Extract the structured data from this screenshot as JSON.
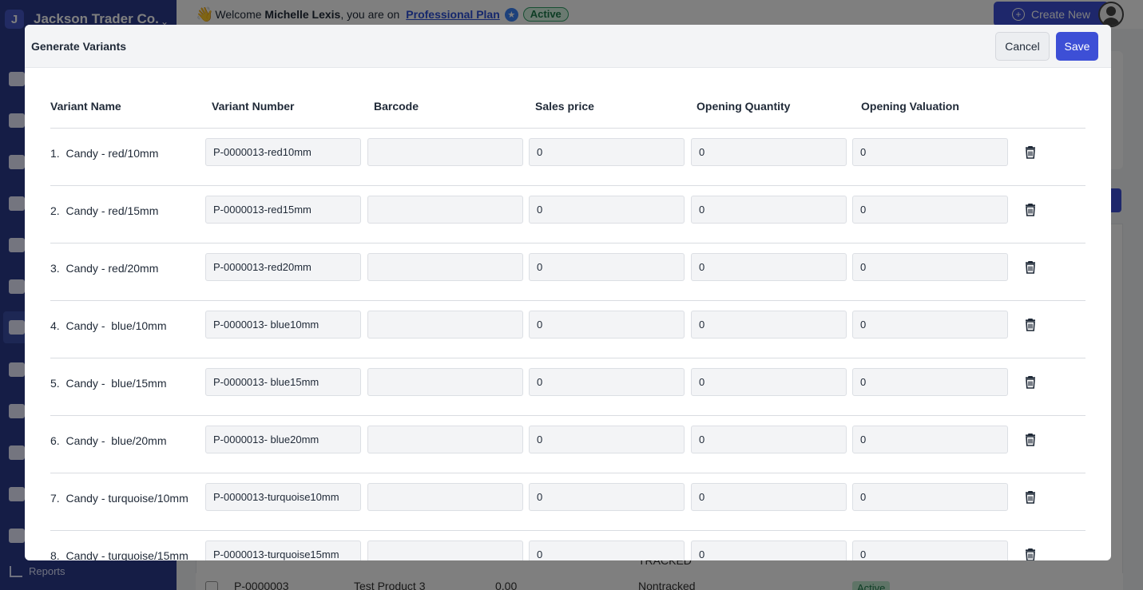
{
  "sidebar": {
    "company_initial": "J",
    "company_name": "Jackson Trader Co.",
    "reports_label": "Reports"
  },
  "topbar": {
    "welcome": "Welcome",
    "user_name": "Michelle Lexis",
    "on_text": ", you are on",
    "plan_name": "Professional Plan",
    "plan_status": "Active",
    "create_new_label": "Create New"
  },
  "background_table": {
    "row_sku": "P-0000003",
    "row_name": "Test Product 3",
    "row_price": "0.00",
    "row_tracking": "Nontracked",
    "tracked_text": "TRACKED",
    "row_status": "Active"
  },
  "modal": {
    "title": "Generate Variants",
    "cancel_label": "Cancel",
    "save_label": "Save",
    "columns": {
      "name": "Variant Name",
      "number": "Variant Number",
      "barcode": "Barcode",
      "sales_price": "Sales price",
      "opening_quantity": "Opening Quantity",
      "opening_valuation": "Opening Valuation"
    },
    "variants": [
      {
        "label": "1.  Candy - red/10mm",
        "number": "P-0000013-red10mm",
        "barcode": "",
        "sales_price": "0",
        "opening_quantity": "0",
        "opening_valuation": "0"
      },
      {
        "label": "2.  Candy - red/15mm",
        "number": "P-0000013-red15mm",
        "barcode": "",
        "sales_price": "0",
        "opening_quantity": "0",
        "opening_valuation": "0"
      },
      {
        "label": "3.  Candy - red/20mm",
        "number": "P-0000013-red20mm",
        "barcode": "",
        "sales_price": "0",
        "opening_quantity": "0",
        "opening_valuation": "0"
      },
      {
        "label": "4.  Candy -  blue/10mm",
        "number": "P-0000013- blue10mm",
        "barcode": "",
        "sales_price": "0",
        "opening_quantity": "0",
        "opening_valuation": "0"
      },
      {
        "label": "5.  Candy -  blue/15mm",
        "number": "P-0000013- blue15mm",
        "barcode": "",
        "sales_price": "0",
        "opening_quantity": "0",
        "opening_valuation": "0"
      },
      {
        "label": "6.  Candy -  blue/20mm",
        "number": "P-0000013- blue20mm",
        "barcode": "",
        "sales_price": "0",
        "opening_quantity": "0",
        "opening_valuation": "0"
      },
      {
        "label": "7.  Candy - turquoise/10mm",
        "number": "P-0000013-turquoise10mm",
        "barcode": "",
        "sales_price": "0",
        "opening_quantity": "0",
        "opening_valuation": "0"
      },
      {
        "label": "8.  Candy - turquoise/15mm",
        "number": "P-0000013-turquoise15mm",
        "barcode": "",
        "sales_price": "0",
        "opening_quantity": "0",
        "opening_valuation": "0"
      }
    ]
  },
  "colors": {
    "primary": "#3d4fd6",
    "sidebar": "#2b3a8c",
    "active_badge": "#d7f5e3"
  },
  "icons": [
    "dashboard-icon",
    "quotes-icon",
    "invoice-icon",
    "purchase-order-icon",
    "bills-icon",
    "contacts-icon",
    "products-icon",
    "bank-icon",
    "tags-icon",
    "shipping-icon",
    "warehouse-icon",
    "apps-icon",
    "reports-icon",
    "trash-icon",
    "create-new-icon",
    "user-avatar-icon"
  ]
}
